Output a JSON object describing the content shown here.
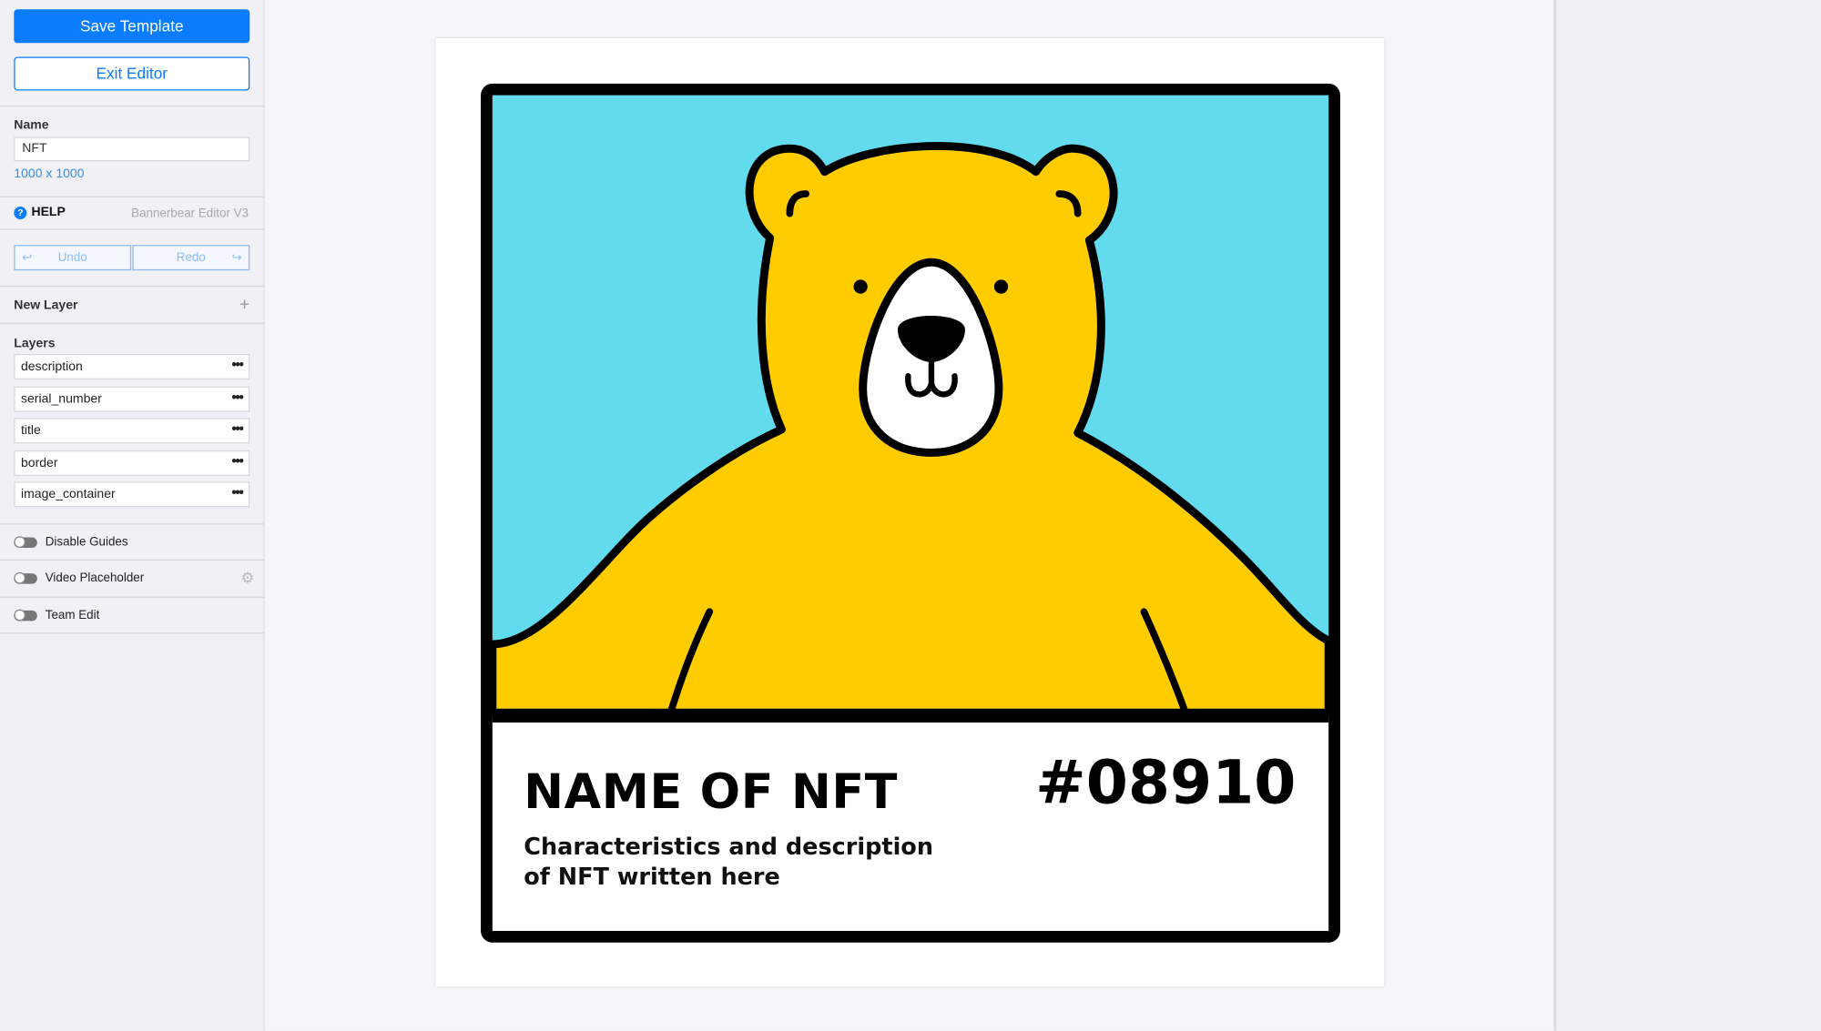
{
  "sidebar": {
    "save_label": "Save Template",
    "exit_label": "Exit Editor",
    "name_label": "Name",
    "name_value": "NFT",
    "dimensions": "1000 x 1000",
    "help_label": "HELP",
    "version": "Bannerbear Editor V3",
    "undo_label": "Undo",
    "redo_label": "Redo",
    "new_layer_label": "New Layer",
    "layers_label": "Layers",
    "layers": [
      {
        "name": "description"
      },
      {
        "name": "serial_number"
      },
      {
        "name": "title"
      },
      {
        "name": "border"
      },
      {
        "name": "image_container"
      }
    ],
    "toggles": [
      {
        "label": "Disable Guides",
        "on": false
      },
      {
        "label": "Video Placeholder",
        "on": false
      },
      {
        "label": "Team Edit",
        "on": false
      }
    ]
  },
  "canvas": {
    "title": "NAME OF NFT",
    "serial": "#08910",
    "description": "Characteristics and description of NFT written here",
    "colors": {
      "sky": "#62DBEE",
      "bear": "#FFCC00",
      "border": "#000000",
      "accent": "#0A7CFF"
    }
  }
}
